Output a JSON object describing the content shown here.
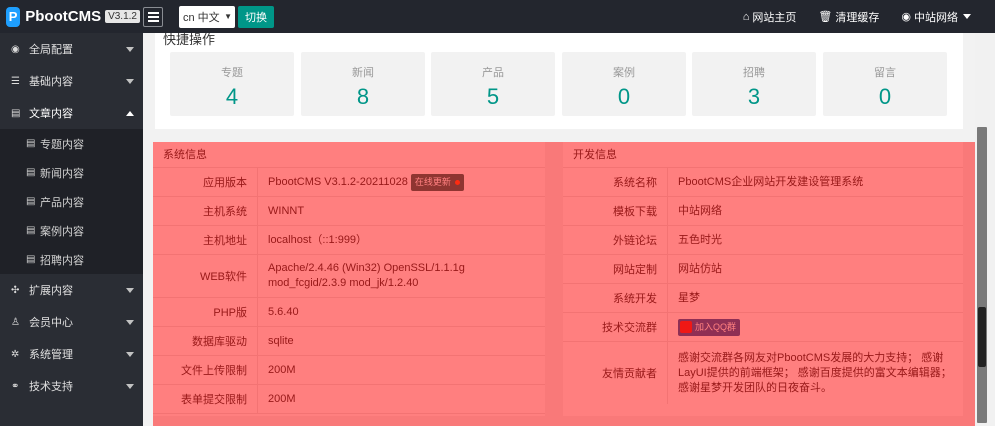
{
  "header": {
    "logo_text": "PbootCMS",
    "version": "V3.1.2",
    "language": "cn 中文",
    "switch_label": "切换",
    "links": [
      {
        "label": "网站主页",
        "icon": "home-icon"
      },
      {
        "label": "清理缓存",
        "icon": "trash-icon"
      },
      {
        "label": "中站网络",
        "icon": "user-circle-icon"
      }
    ]
  },
  "sidebar": {
    "items": [
      {
        "label": "全局配置"
      },
      {
        "label": "基础内容"
      },
      {
        "label": "文章内容"
      },
      {
        "label": "扩展内容"
      },
      {
        "label": "会员中心"
      },
      {
        "label": "系统管理"
      },
      {
        "label": "技术支持"
      }
    ],
    "sub_items": [
      {
        "label": "专题内容"
      },
      {
        "label": "新闻内容"
      },
      {
        "label": "产品内容"
      },
      {
        "label": "案例内容"
      },
      {
        "label": "招聘内容"
      }
    ]
  },
  "quick": {
    "title": "快捷操作",
    "stats": [
      {
        "label": "专题",
        "value": "4"
      },
      {
        "label": "新闻",
        "value": "8"
      },
      {
        "label": "产品",
        "value": "5"
      },
      {
        "label": "案例",
        "value": "0"
      },
      {
        "label": "招聘",
        "value": "3"
      },
      {
        "label": "留言",
        "value": "0"
      }
    ]
  },
  "system_info": {
    "title": "系统信息",
    "update_badge": "在线更新",
    "rows": [
      {
        "k": "应用版本",
        "v": "PbootCMS V3.1.2-20211028"
      },
      {
        "k": "主机系统",
        "v": "WINNT"
      },
      {
        "k": "主机地址",
        "v": "localhost（::1:999）"
      },
      {
        "k": "WEB软件",
        "v": "Apache/2.4.46 (Win32) OpenSSL/1.1.1g mod_fcgid/2.3.9 mod_jk/1.2.40"
      },
      {
        "k": "PHP版",
        "v": "5.6.40"
      },
      {
        "k": "数据库驱动",
        "v": "sqlite"
      },
      {
        "k": "文件上传限制",
        "v": "200M"
      },
      {
        "k": "表单提交限制",
        "v": "200M"
      }
    ]
  },
  "dev_info": {
    "title": "开发信息",
    "qq_label": "加入QQ群",
    "rows": [
      {
        "k": "系统名称",
        "v": "PbootCMS企业网站开发建设管理系统"
      },
      {
        "k": "模板下载",
        "v": "中站网络"
      },
      {
        "k": "外链论坛",
        "v": "五色时光"
      },
      {
        "k": "网站定制",
        "v": "网站仿站"
      },
      {
        "k": "系统开发",
        "v": "星梦"
      },
      {
        "k": "技术交流群",
        "v": ""
      },
      {
        "k": "友情贡献者",
        "v": "感谢交流群各网友对PbootCMS发展的大力支持； 感谢LayUI提供的前端框架； 感谢百度提供的富文本编辑器； 感谢星梦开发团队的日夜奋斗。"
      }
    ]
  }
}
